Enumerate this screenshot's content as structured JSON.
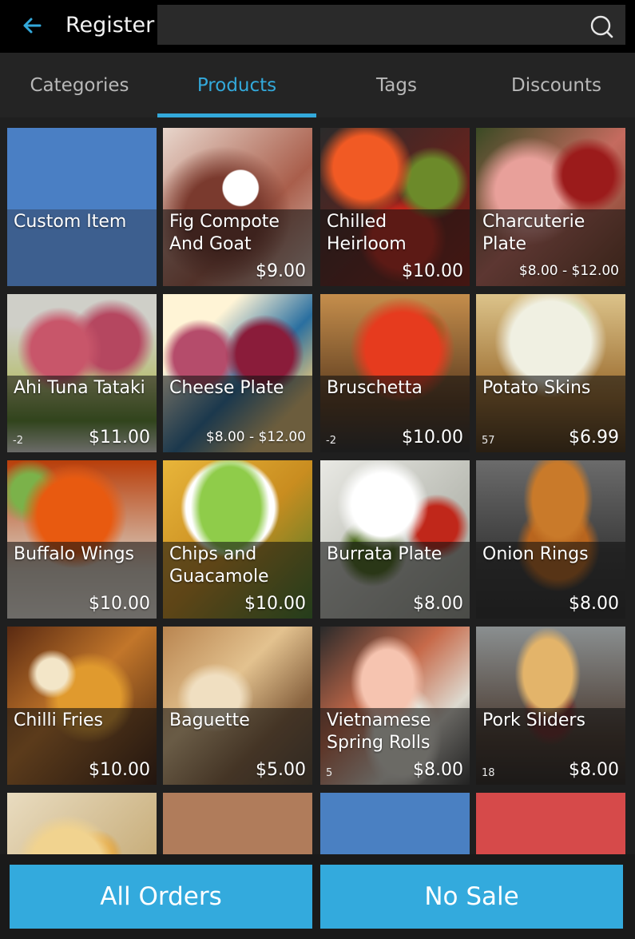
{
  "header": {
    "back_icon": "arrow-left-icon",
    "title": "Register",
    "search_value": "",
    "search_icon": "search-icon"
  },
  "tabs": [
    {
      "label": "Categories",
      "active": false
    },
    {
      "label": "Products",
      "active": true
    },
    {
      "label": "Tags",
      "active": false
    },
    {
      "label": "Discounts",
      "active": false
    }
  ],
  "accent_color": "#33a9db",
  "products": [
    {
      "name": "Custom Item",
      "price": "",
      "qty": ""
    },
    {
      "name": "Fig Compote And Goat",
      "price": "$9.00",
      "qty": ""
    },
    {
      "name": "Chilled Heirloom",
      "price": "$10.00",
      "qty": ""
    },
    {
      "name": "Charcuterie Plate",
      "price": "$8.00 - $12.00",
      "qty": ""
    },
    {
      "name": "Ahi Tuna Tataki",
      "price": "$11.00",
      "qty": "-2"
    },
    {
      "name": "Cheese Plate",
      "price": "$8.00 - $12.00",
      "qty": ""
    },
    {
      "name": "Bruschetta",
      "price": "$10.00",
      "qty": "-2"
    },
    {
      "name": "Potato Skins",
      "price": "$6.99",
      "qty": "57"
    },
    {
      "name": "Buffalo Wings",
      "price": "$10.00",
      "qty": ""
    },
    {
      "name": "Chips and Guacamole",
      "price": "$10.00",
      "qty": ""
    },
    {
      "name": "Burrata Plate",
      "price": "$8.00",
      "qty": ""
    },
    {
      "name": "Onion Rings",
      "price": "$8.00",
      "qty": ""
    },
    {
      "name": "Chilli Fries",
      "price": "$10.00",
      "qty": ""
    },
    {
      "name": "Baguette",
      "price": "$5.00",
      "qty": ""
    },
    {
      "name": "Vietnamese Spring Rolls",
      "price": "$8.00",
      "qty": "5"
    },
    {
      "name": "Pork Sliders",
      "price": "$8.00",
      "qty": "18"
    }
  ],
  "partial_row_colors": [
    "#b07c5b",
    "#4a80c2",
    "#d64a4a"
  ],
  "footer": {
    "all_orders_label": "All Orders",
    "no_sale_label": "No Sale"
  }
}
